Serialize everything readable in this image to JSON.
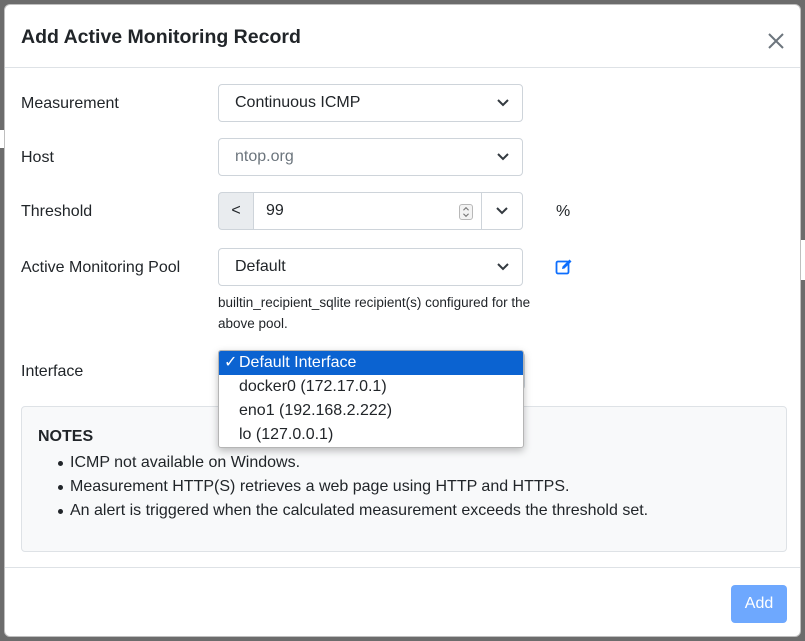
{
  "dialog": {
    "title": "Add Active Monitoring Record",
    "close_icon": "close-icon"
  },
  "form": {
    "measurement": {
      "label": "Measurement",
      "value": "Continuous ICMP"
    },
    "host": {
      "label": "Host",
      "placeholder": "ntop.org"
    },
    "threshold": {
      "label": "Threshold",
      "operator": "<",
      "value": "99",
      "unit": "%"
    },
    "pool": {
      "label": "Active Monitoring Pool",
      "value": "Default",
      "help": "builtin_recipient_sqlite recipient(s) configured for the above pool.",
      "edit_icon": "edit-icon"
    },
    "interface": {
      "label": "Interface",
      "options": [
        {
          "label": "Default Interface",
          "check": "✓"
        },
        {
          "label": "docker0 (172.17.0.1)",
          "check": ""
        },
        {
          "label": "eno1 (192.168.2.222)",
          "check": ""
        },
        {
          "label": "lo (127.0.0.1)",
          "check": ""
        }
      ]
    }
  },
  "notes": {
    "title": "NOTES",
    "items": [
      "ICMP not available on Windows.",
      "Measurement HTTP(S) retrieves a web page using HTTP and HTTPS.",
      "An alert is triggered when the calculated measurement exceeds the threshold set."
    ]
  },
  "footer": {
    "add_label": "Add"
  },
  "colors": {
    "primary": "#6ea8fe",
    "selected_option": "#0b63d1",
    "notes_bg": "#f8f9fa"
  }
}
